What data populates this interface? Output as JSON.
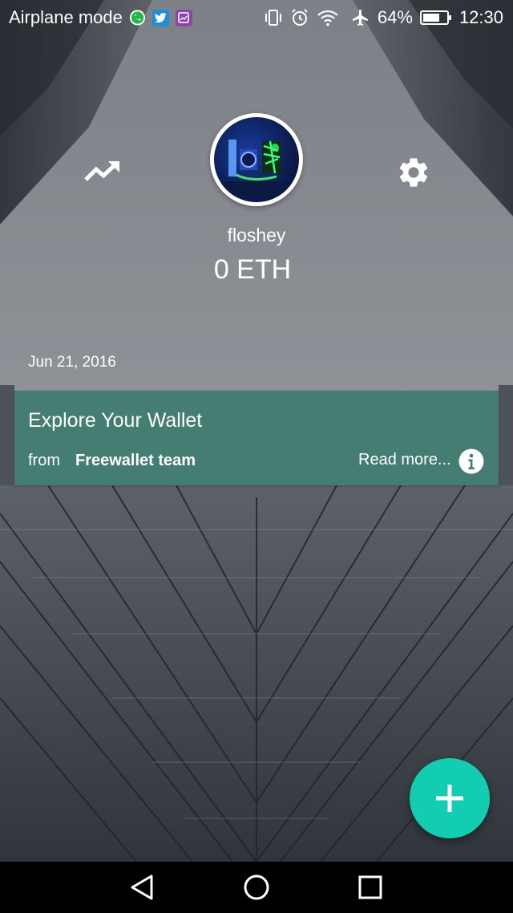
{
  "status_bar": {
    "carrier_text": "Airplane mode",
    "battery_percent": "64%",
    "time": "12:30",
    "notification_icons": [
      "whatsapp-icon",
      "twitter-icon",
      "gallery-icon"
    ],
    "status_icons": [
      "vibrate-icon",
      "alarm-icon",
      "wifi-icon",
      "airplane-icon",
      "battery-icon"
    ]
  },
  "header": {
    "trend_icon": "trending-up-icon",
    "settings_icon": "gear-icon",
    "username": "floshey",
    "balance": "0 ETH"
  },
  "feed": {
    "date": "Jun 21, 2016",
    "cards": [
      {
        "title": "Explore Your Wallet",
        "from_label": "from",
        "author": "Freewallet team",
        "read_more": "Read more...",
        "info_icon": "info-icon"
      }
    ]
  },
  "fab": {
    "icon": "plus-icon",
    "color": "#13cdb3"
  },
  "nav_bar": {
    "buttons": [
      "back-icon",
      "home-icon",
      "recents-icon"
    ]
  },
  "colors": {
    "card": "#437c71",
    "fab": "#13cdb3"
  }
}
